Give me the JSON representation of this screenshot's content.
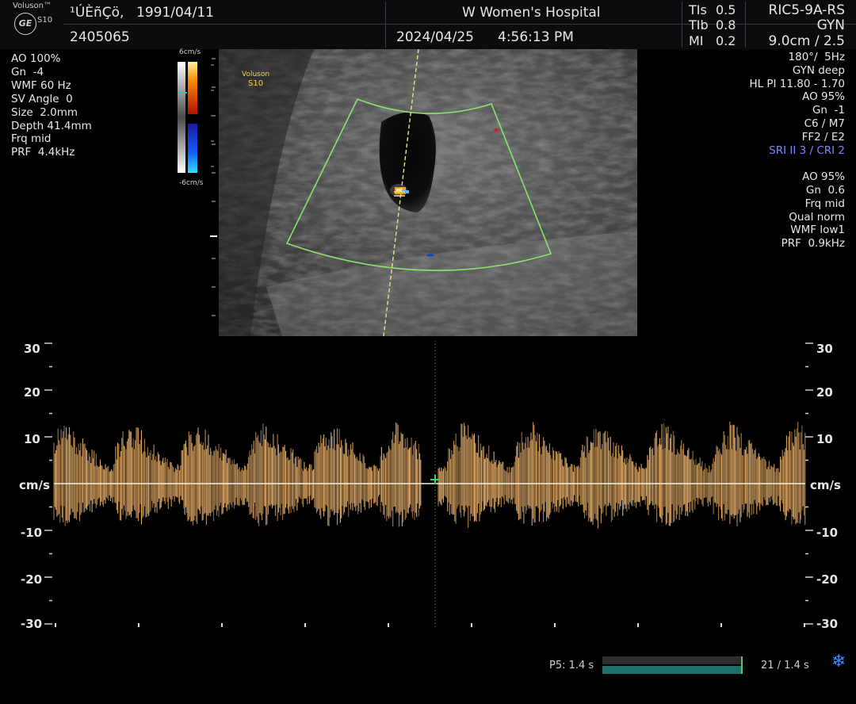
{
  "header": {
    "brand": "Voluson™",
    "logo_text": "GE",
    "model": "S10",
    "patient_name": "¹ÚÈñÇö,",
    "dob": "1991/04/11",
    "patient_id": "2405065",
    "hospital": "W Women's Hospital",
    "date": "2024/04/25",
    "time": "4:56:13 PM",
    "tis_label": "TIs",
    "tis_value": "0.5",
    "tib_label": "TIb",
    "tib_value": "0.8",
    "mi_label": "MI",
    "mi_value": "0.2",
    "probe": "RIC5-9A-RS",
    "application": "GYN",
    "depth_zoom": "9.0cm / 2.5"
  },
  "left_params": [
    "AO 100%",
    "Gn  -4",
    "WMF 60 Hz",
    "SV Angle  0",
    "Size  2.0mm",
    "Depth 41.4mm",
    "Frq mid",
    "PRF  4.4kHz"
  ],
  "right_params_top": [
    "180°/  5Hz",
    "GYN deep",
    "HL PI 11.80 - 1.70",
    "AO 95%",
    "Gn  -1",
    "C6 / M7",
    "FF2 / E2"
  ],
  "right_params_sri": "SRI II 3 / CRI 2",
  "right_params_bottom": [
    "AO 95%",
    "Gn  0.6",
    "Frq mid",
    "Qual norm",
    "WMF low1",
    "PRF  0.9kHz"
  ],
  "color_bar": {
    "top_label": "6cm/s",
    "bottom_label": "-6cm/s"
  },
  "image_overlay": {
    "brand": "Voluson",
    "model": "S10"
  },
  "doppler": {
    "unit": "cm/s",
    "scale_left": [
      "30",
      "20",
      "10",
      "-10",
      "-20",
      "-30"
    ],
    "scale_right": [
      "30",
      "20",
      "10",
      "-10",
      "-20",
      "-30"
    ],
    "waveform_color": "#e9b06a",
    "baseline_color": "#f2efe6"
  },
  "bottom_bar": {
    "p5_label": "P5:  1.4 s",
    "frames_label": "21 / 1.4 s",
    "freeze_icon": "snowflake-icon",
    "progress_fraction": 1.0
  }
}
